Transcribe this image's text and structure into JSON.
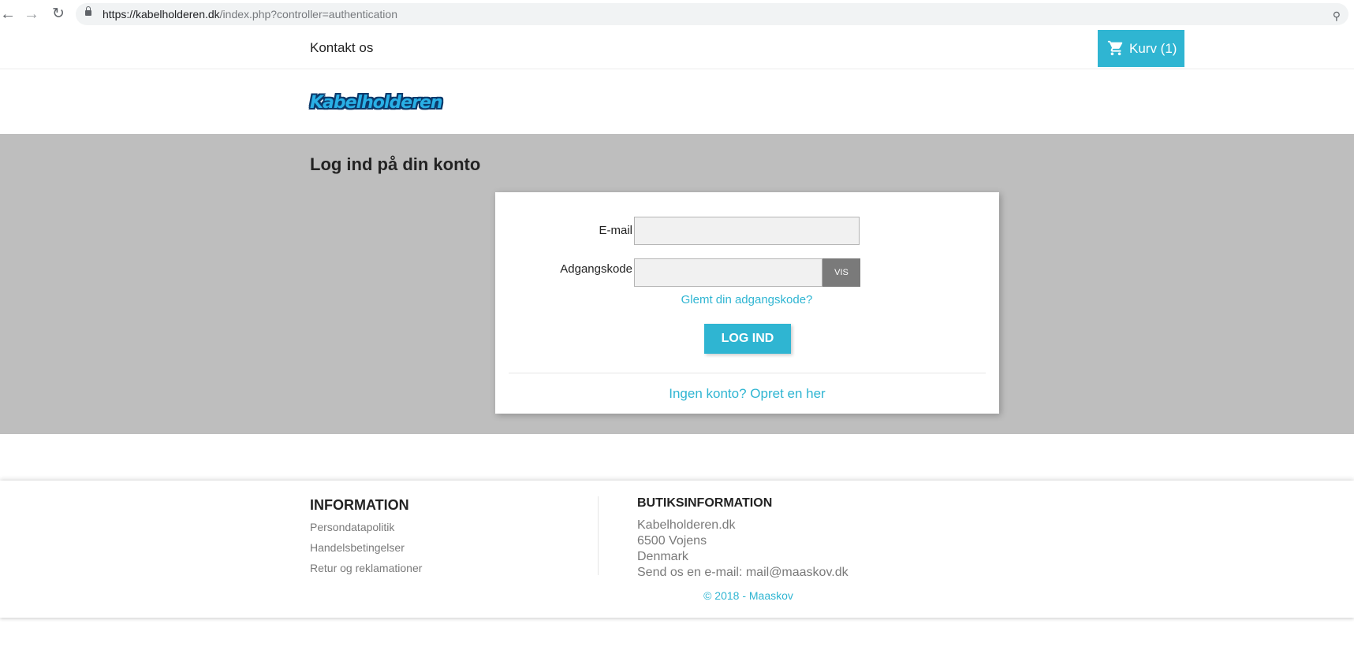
{
  "browser": {
    "url_host": "https://kabelholderen.dk",
    "url_path": "/index.php?controller=authentication"
  },
  "topnav": {
    "contact_label": "Kontakt os",
    "cart_label": "Kurv (1)"
  },
  "header": {
    "logo_text": "Kabelholderen"
  },
  "login": {
    "title": "Log ind på din konto",
    "email_label": "E-mail",
    "email_value": "",
    "password_label": "Adgangskode",
    "password_value": "",
    "show_label": "VIS",
    "forgot_label": "Glemt din adgangskode?",
    "submit_label": "LOG IND",
    "create_account_label": "Ingen konto? Opret en her"
  },
  "footer": {
    "info_title": "INFORMATION",
    "info_links": [
      "Persondatapolitik",
      "Handelsbetingelser",
      "Retur og reklamationer"
    ],
    "store_title": "BUTIKSINFORMATION",
    "store_lines": [
      "Kabelholderen.dk",
      "6500 Vojens",
      "Denmark",
      "Send os en e-mail: mail@maaskov.dk"
    ],
    "copyright": "© 2018 - Maaskov"
  },
  "colors": {
    "accent": "#2fb5d2",
    "page_background": "#bebebe",
    "show_button": "#7a7a7a"
  }
}
